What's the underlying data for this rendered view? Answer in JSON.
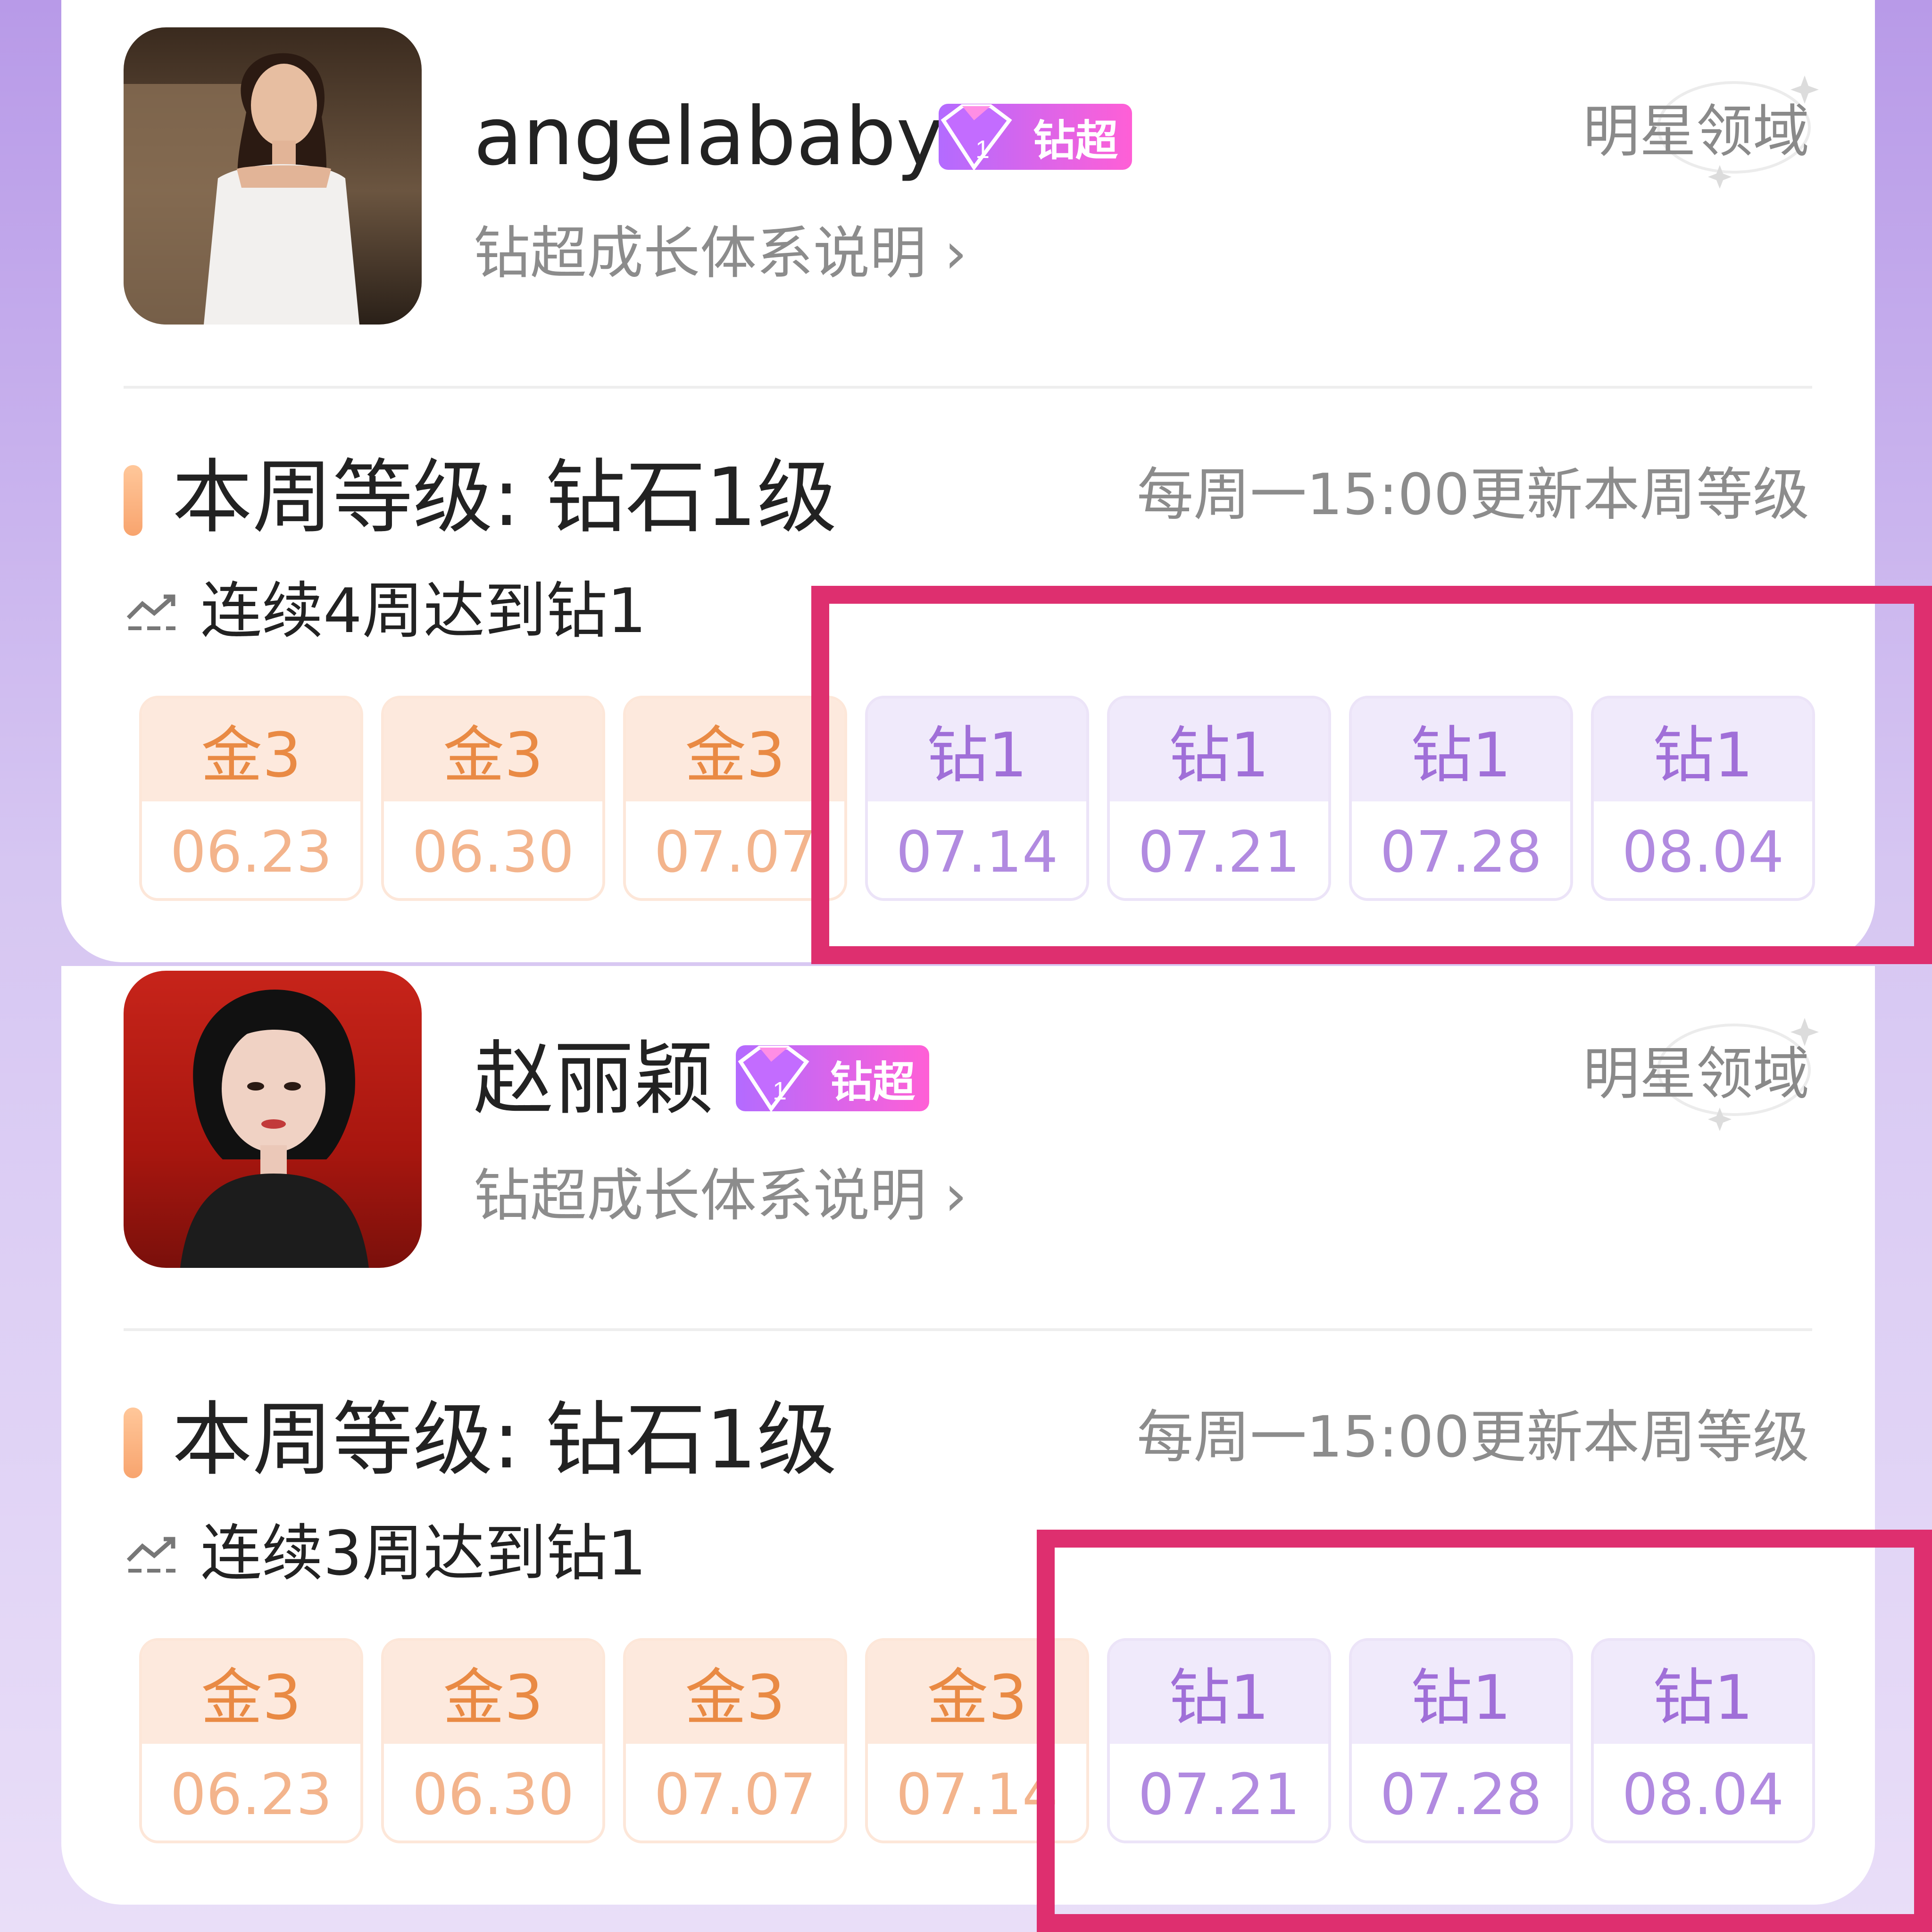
{
  "cards": [
    {
      "name": "angelababy",
      "badge_label": "钻超",
      "realm_label": "明星领域",
      "growth_link": "钻超成长体系说明 ›",
      "level_text": "本周等级: 钻石1级",
      "update_text": "每周一15:00更新本周等级",
      "streak_text": "连续4周达到钻1",
      "weeks": [
        {
          "level": "金3",
          "date": "06.23",
          "tier": "gold"
        },
        {
          "level": "金3",
          "date": "06.30",
          "tier": "gold"
        },
        {
          "level": "金3",
          "date": "07.07",
          "tier": "gold"
        },
        {
          "level": "钻1",
          "date": "07.14",
          "tier": "diamond"
        },
        {
          "level": "钻1",
          "date": "07.21",
          "tier": "diamond"
        },
        {
          "level": "钻1",
          "date": "07.28",
          "tier": "diamond"
        },
        {
          "level": "钻1",
          "date": "08.04",
          "tier": "diamond"
        }
      ]
    },
    {
      "name": "赵丽颖",
      "badge_label": "钻超",
      "realm_label": "明星领域",
      "growth_link": "钻超成长体系说明 ›",
      "level_text": "本周等级: 钻石1级",
      "update_text": "每周一15:00更新本周等级",
      "streak_text": "连续3周达到钻1",
      "weeks": [
        {
          "level": "金3",
          "date": "06.23",
          "tier": "gold"
        },
        {
          "level": "金3",
          "date": "06.30",
          "tier": "gold"
        },
        {
          "level": "金3",
          "date": "07.07",
          "tier": "gold"
        },
        {
          "level": "金3",
          "date": "07.14",
          "tier": "gold"
        },
        {
          "level": "钻1",
          "date": "07.21",
          "tier": "diamond"
        },
        {
          "level": "钻1",
          "date": "07.28",
          "tier": "diamond"
        },
        {
          "level": "钻1",
          "date": "08.04",
          "tier": "diamond"
        }
      ]
    }
  ],
  "colors": {
    "highlight": "#de2f6f",
    "gold_text": "#e98a44",
    "diamond_text": "#a06fd8",
    "badge_gradient_start": "#b36bff",
    "badge_gradient_end": "#ff5fd6"
  },
  "icons": {
    "badge": "diamond-gem-icon",
    "streak": "trend-up-icon",
    "realm": "sparkle-icon",
    "link": "chevron-right-icon"
  }
}
